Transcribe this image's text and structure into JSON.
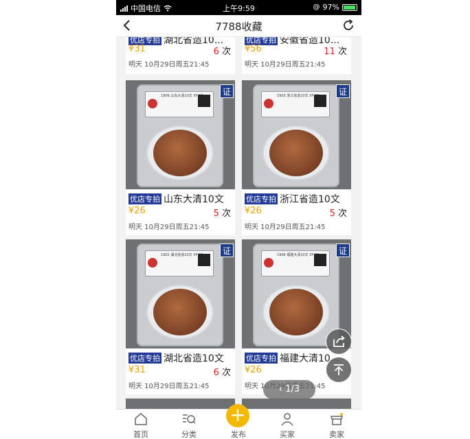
{
  "status_bar": {
    "carrier": "中国电信",
    "time": "上午9:59",
    "battery": "97%"
  },
  "nav": {
    "title": "7788收藏"
  },
  "shop_tag": "优店专拍",
  "bids_unit": "次",
  "partial_top": [
    {
      "title": "湖北省造10...",
      "price": "¥31",
      "bids": "6",
      "time": "明天 10月29日周五21:45"
    },
    {
      "title": "安徽省造10...",
      "price": "¥56",
      "bids": "11",
      "time": "明天 10月29日周五21:45"
    }
  ],
  "items": [
    {
      "title": "山东大清10文",
      "price": "¥26",
      "bids": "5",
      "time": "明天 10月29日周五21:45",
      "slab_text": "1906 山东大清10文 XF 02"
    },
    {
      "title": "浙江省造10文",
      "price": "¥26",
      "bids": "5",
      "time": "明天 10月29日周五21:45",
      "slab_text": "1903 浙江省造10文 XF 02"
    },
    {
      "title": "湖北省造10文",
      "price": "¥31",
      "bids": "6",
      "time": "明天 10月29日周五21:45",
      "slab_text": "1902 湖北省造10文 XF 02"
    },
    {
      "title": "福建大清10...",
      "price": "¥26",
      "bids": "",
      "time": "明天 10月29日周五21:45",
      "slab_text": "1906 福建大清10文 XF 02"
    }
  ],
  "cert_badge": "证",
  "pager": "1/3",
  "tabbar": [
    {
      "label": "首页",
      "icon": "home-icon"
    },
    {
      "label": "分类",
      "icon": "category-search-icon"
    },
    {
      "label": "发布",
      "icon": "plus-icon"
    },
    {
      "label": "买家",
      "icon": "user-icon"
    },
    {
      "label": "卖家",
      "icon": "store-icon"
    }
  ],
  "colors": {
    "price": "#f0a000",
    "bids": "#e02020",
    "tag": "#243a99",
    "publish": "#f5b800"
  }
}
